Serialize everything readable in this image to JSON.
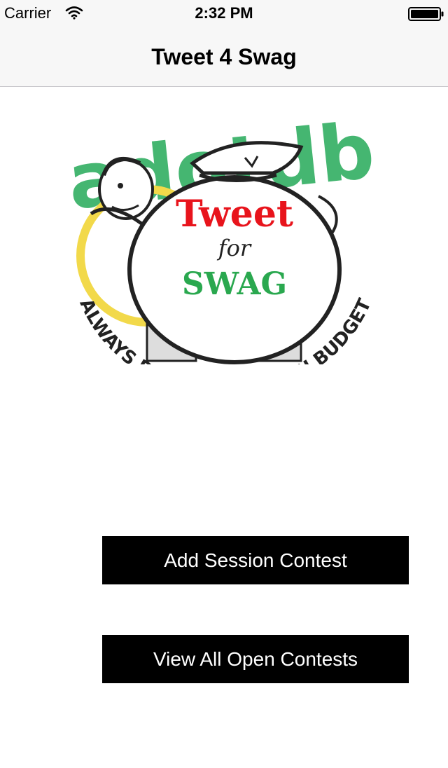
{
  "status_bar": {
    "carrier": "Carrier",
    "time": "2:32 PM",
    "wifi_icon": "wifi-icon",
    "battery_icon": "battery-icon"
  },
  "nav": {
    "title": "Tweet 4 Swag"
  },
  "logo": {
    "arc_text": "adotdb",
    "ring_text": "ALWAYS DONE ON TIME ON BUDGET",
    "bag_line1": "Tweet",
    "bag_line2": "for",
    "bag_line3": "SWAG",
    "colors": {
      "green": "#3cb36a",
      "red": "#e8141c",
      "yellow": "#f2d94a",
      "ink": "#222222"
    }
  },
  "buttons": {
    "add_session": "Add Session Contest",
    "view_open": "View All Open Contests"
  }
}
